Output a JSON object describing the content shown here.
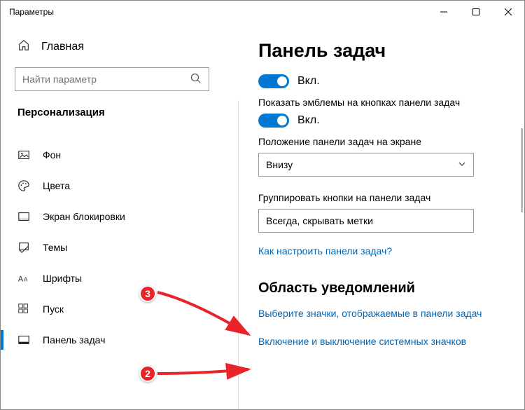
{
  "window": {
    "title": "Параметры"
  },
  "sidebar": {
    "home": "Главная",
    "search_placeholder": "Найти параметр",
    "category": "Персонализация",
    "items": [
      {
        "label": "Фон"
      },
      {
        "label": "Цвета"
      },
      {
        "label": "Экран блокировки"
      },
      {
        "label": "Темы"
      },
      {
        "label": "Шрифты"
      },
      {
        "label": "Пуск"
      },
      {
        "label": "Панель задач"
      }
    ]
  },
  "content": {
    "title": "Панель задач",
    "toggle1": "Вкл.",
    "emblem_label": "Показать эмблемы на кнопках панели задач",
    "toggle2": "Вкл.",
    "position_label": "Положение панели задач на экране",
    "position_value": "Внизу",
    "group_label": "Группировать кнопки на панели задач",
    "group_value": "Всегда, скрывать метки",
    "help_link": "Как настроить панели задач?",
    "section2": "Область уведомлений",
    "link_icons": "Выберите значки, отображаемые в панели задач",
    "link_system": "Включение и выключение системных значков"
  },
  "annotations": {
    "badge2": "2",
    "badge3": "3"
  }
}
